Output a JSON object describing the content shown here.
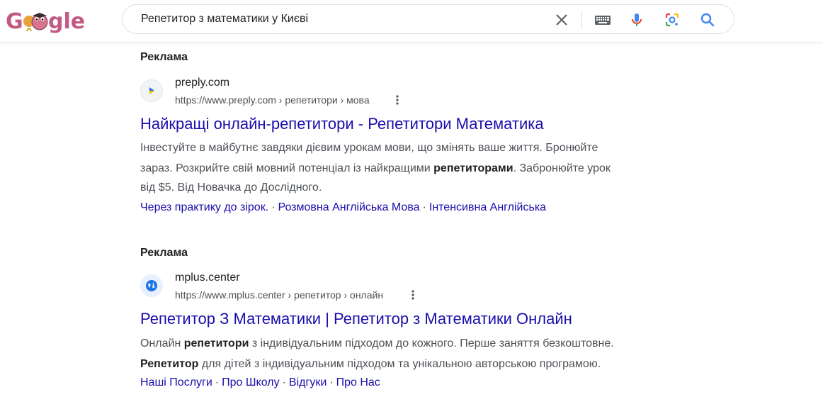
{
  "logo": {
    "text": "Google"
  },
  "search": {
    "query": "Репетитор з математики у Києві"
  },
  "ads": [
    {
      "label": "Реклама",
      "site_name": "preply.com",
      "url": "https://www.preply.com › репетитори › мова",
      "title": "Найкращі онлайн-репетитори - Репетитори Математика",
      "snippet_lines": [
        [
          "Інвестуйте в майбутнє завдяки дієвим урокам мови, що змінять ваше життя. Бронюйте"
        ],
        [
          "зараз. Розкрийте свій мовний потенціал із найкращими ",
          "репетиторами",
          ". Забронюйте урок"
        ],
        [
          "від $5. Від Новачка до Дослідного."
        ]
      ],
      "sitelinks": [
        "Через практику до зірок.",
        "Розмовна Англійська Мова",
        "Інтенсивна Англійська"
      ]
    },
    {
      "label": "Реклама",
      "site_name": "mplus.center",
      "url": "https://www.mplus.center › репетитор › онлайн",
      "title": "Репетитор З Математики | Репетитор з Математики Онлайн",
      "snippet_lines": [
        [
          "Онлайн ",
          "репетитори",
          " з індивідуальним підходом до кожного. Перше заняття безкоштовне."
        ],
        [
          "",
          "Репетитор",
          " для дітей з індивідуальним підходом та унікальною авторською програмою."
        ]
      ],
      "sitelinks": [
        "Наші Послуги",
        "Про Школу",
        "Відгуки",
        "Про Нас"
      ]
    }
  ]
}
